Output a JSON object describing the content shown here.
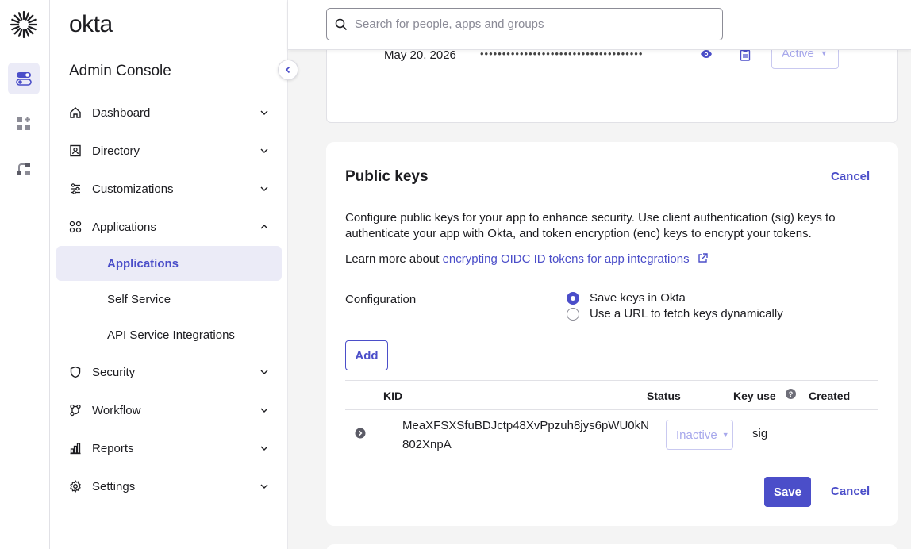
{
  "brand": {
    "logo_text": "okta",
    "console_title": "Admin Console",
    "accent": "#4b4ec9"
  },
  "search": {
    "placeholder": "Search for people, apps and groups"
  },
  "sidebar": {
    "items": [
      {
        "label": "Dashboard",
        "icon": "home-icon",
        "expanded": false
      },
      {
        "label": "Directory",
        "icon": "directory-icon",
        "expanded": false
      },
      {
        "label": "Customizations",
        "icon": "sliders-icon",
        "expanded": false
      },
      {
        "label": "Applications",
        "icon": "apps-grid-icon",
        "expanded": true
      },
      {
        "label": "Security",
        "icon": "shield-icon",
        "expanded": false
      },
      {
        "label": "Workflow",
        "icon": "workflow-icon",
        "expanded": false
      },
      {
        "label": "Reports",
        "icon": "reports-icon",
        "expanded": false
      },
      {
        "label": "Settings",
        "icon": "gear-icon",
        "expanded": false
      }
    ],
    "sub_items": [
      "Applications",
      "Self Service",
      "API Service Integrations"
    ],
    "active_sub": "Applications"
  },
  "secret_row": {
    "date": "May 20, 2026",
    "masked": "•••••••••••••••••••••••••••••••••••••",
    "status": "Active"
  },
  "public_keys": {
    "title": "Public keys",
    "cancel_label": "Cancel",
    "description": "Configure public keys for your app to enhance security. Use client authentication (sig) keys to authenticate your app with Okta, and token encryption (enc) keys to encrypt your tokens.",
    "learn_prefix": "Learn more about ",
    "learn_link": "encrypting OIDC ID tokens for app integrations",
    "configuration_label": "Configuration",
    "options": [
      "Save keys in Okta",
      "Use a URL to fetch keys dynamically"
    ],
    "selected_option": "Save keys in Okta",
    "add_label": "Add",
    "table": {
      "headers": [
        "KID",
        "Status",
        "Key use",
        "Created"
      ],
      "rows": [
        {
          "kid_line1": "MeaXFSXSfuBDJctp48XvPpzuh8jys6pWU0kN",
          "kid_line2": "802XnpA",
          "status": "Inactive",
          "key_use": "sig",
          "created": ""
        }
      ]
    },
    "save_label": "Save",
    "cancel_bottom_label": "Cancel"
  }
}
